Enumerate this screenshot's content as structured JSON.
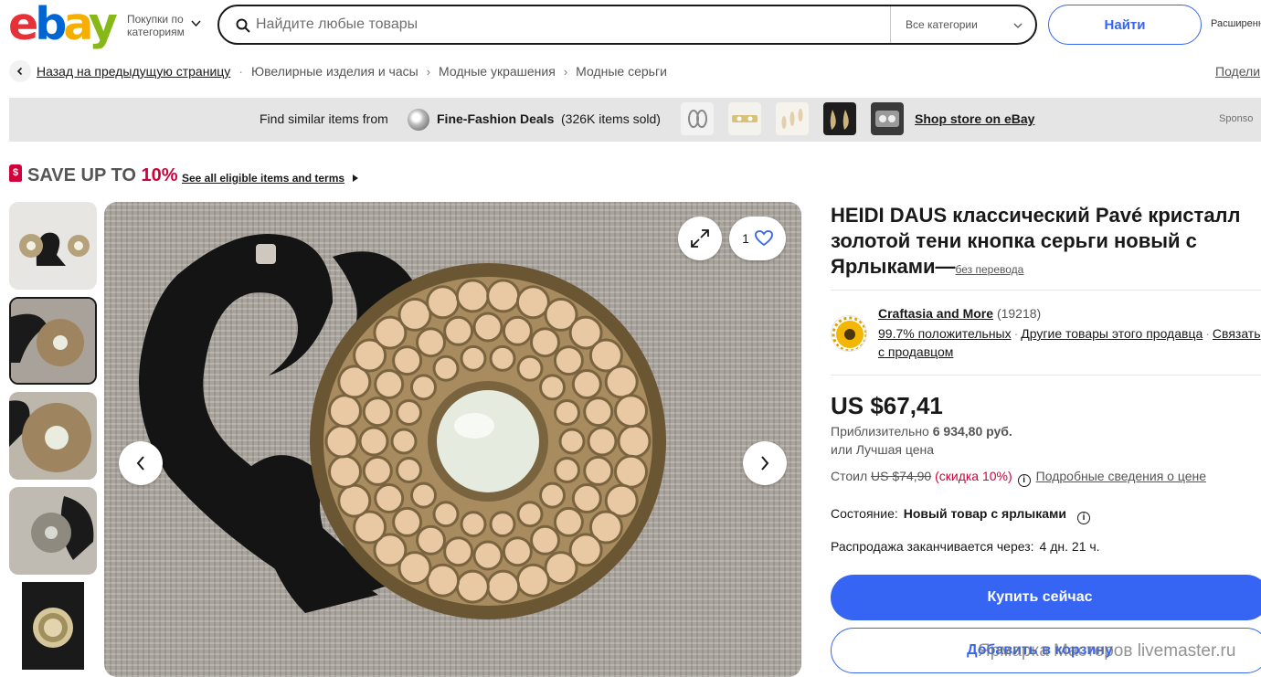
{
  "header": {
    "logo": {
      "e": "e",
      "b": "b",
      "a": "a",
      "y": "y"
    },
    "shop_by": "Покупки по категориям",
    "search_placeholder": "Найдите любые товары",
    "category": "Все категории",
    "find_label": "Найти",
    "advanced": "Расширенн"
  },
  "breadcrumb": {
    "back": "Назад на предыдущую страницу",
    "items": [
      "Ювелирные изделия и часы",
      "Модные украшения",
      "Модные серьги"
    ],
    "share": "Подели"
  },
  "similar": {
    "lead": "Find similar items from",
    "store": "Fine-Fashion Deals",
    "sold": "(326K items sold)",
    "shop_store": "Shop store on eBay",
    "sponsored": "Sponso"
  },
  "promo": {
    "tag": "$",
    "save_text": "SAVE UP TO ",
    "save_pct": "10%",
    "eligible": "See all eligible items and terms"
  },
  "gallery": {
    "watch_count": "1",
    "thumbnail_count": 5,
    "active_thumbnail": 2
  },
  "listing": {
    "title": "HEIDI DAUS классический Pavé кристалл золотой тени кнопка серьги новый с Ярлыками—",
    "title_note": "без перевода",
    "seller_name": "Craftasia and More",
    "seller_count": "(19218)",
    "seller_positive": "99.7% положительных",
    "seller_other": "Другие товары этого продавца",
    "seller_contact": "Связать с продавцом",
    "price": "US $67,41",
    "approx_label": "Приблизительно",
    "approx_value": "6 934,80 руб.",
    "best_offer": "или Лучшая цена",
    "was_label": "Стоил",
    "was_price": "US $74,90",
    "discount": "(скидка 10%)",
    "price_details": "Подробные сведения о цене",
    "condition_label": "Состояние:",
    "condition_value": "Новый товар с ярлыками",
    "ends_label": "Распродажа заканчивается через:",
    "ends_value": "4 дн. 21 ч.",
    "buy_label": "Купить сейчас",
    "cart_label": "Добавить в корзину"
  },
  "watermark": "Ярмарка Мастеров livemaster.ru",
  "colors": {
    "accent": "#3665f3",
    "sale": "#d2003a",
    "bar": "#e5e5e5"
  }
}
